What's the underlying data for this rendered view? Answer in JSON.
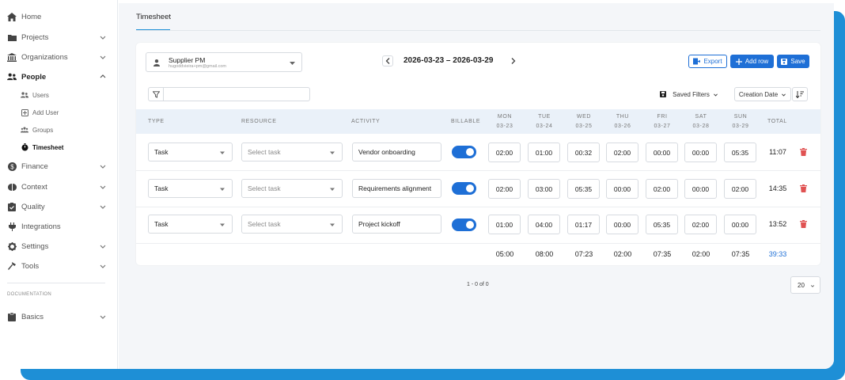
{
  "sidebar": {
    "items": [
      {
        "label": "Home",
        "icon": "home-icon"
      },
      {
        "label": "Projects",
        "icon": "folder-icon"
      },
      {
        "label": "Organizations",
        "icon": "bank-icon"
      },
      {
        "label": "People",
        "icon": "people-icon"
      },
      {
        "label": "Finance",
        "icon": "dollar-icon"
      },
      {
        "label": "Context",
        "icon": "brain-icon"
      },
      {
        "label": "Quality",
        "icon": "clipboard-check-icon"
      },
      {
        "label": "Integrations",
        "icon": "plug-icon"
      },
      {
        "label": "Settings",
        "icon": "gear-icon"
      },
      {
        "label": "Tools",
        "icon": "hammer-icon"
      }
    ],
    "sub_items": [
      {
        "label": "Users"
      },
      {
        "label": "Add User"
      },
      {
        "label": "Groups"
      },
      {
        "label": "Timesheet"
      }
    ],
    "doc_label": "DOCUMENTATION",
    "doc_items": [
      {
        "label": "Basics",
        "icon": "clipboard-icon"
      }
    ]
  },
  "page": {
    "title": "Timesheet"
  },
  "toolbar": {
    "supplier_name": "Supplier PM",
    "supplier_email": "hugoddvieira+pm@gmail.com",
    "date_range": "2026-03-23 – 2026-03-29",
    "export_label": "Export",
    "add_row_label": "Add row",
    "save_label": "Save",
    "filter_placeholder": "",
    "saved_filters_label": "Saved Filters",
    "sort_label": "Creation Date"
  },
  "table": {
    "headers": {
      "type": "TYPE",
      "resource": "RESOURCE",
      "activity": "ACTIVITY",
      "billable": "BILLABLE",
      "total": "TOTAL"
    },
    "days": [
      {
        "day": "MON",
        "date": "03-23"
      },
      {
        "day": "TUE",
        "date": "03-24"
      },
      {
        "day": "WED",
        "date": "03-25"
      },
      {
        "day": "THU",
        "date": "03-26"
      },
      {
        "day": "FRI",
        "date": "03-27"
      },
      {
        "day": "SAT",
        "date": "03-28"
      },
      {
        "day": "SUN",
        "date": "03-29"
      }
    ],
    "rows": [
      {
        "type": "Task",
        "resource": "Select task",
        "activity": "Vendor onboarding",
        "billable": true,
        "times": [
          "02:00",
          "01:00",
          "00:32",
          "02:00",
          "00:00",
          "00:00",
          "05:35"
        ],
        "total": "11:07"
      },
      {
        "type": "Task",
        "resource": "Select task",
        "activity": "Requirements alignment",
        "billable": true,
        "times": [
          "02:00",
          "03:00",
          "05:35",
          "00:00",
          "02:00",
          "00:00",
          "02:00"
        ],
        "total": "14:35"
      },
      {
        "type": "Task",
        "resource": "Select task",
        "activity": "Project kickoff",
        "billable": true,
        "times": [
          "01:00",
          "04:00",
          "01:17",
          "00:00",
          "05:35",
          "02:00",
          "00:00"
        ],
        "total": "13:52"
      }
    ],
    "column_totals": [
      "05:00",
      "08:00",
      "07:23",
      "02:00",
      "07:35",
      "02:00",
      "07:35"
    ],
    "grand_total": "39:33"
  },
  "pagination": {
    "summary": "1 - 0 of 0",
    "page_size": "20"
  },
  "colors": {
    "accent": "#1e6fd6",
    "frame": "#1e8fd6",
    "danger": "#e05252",
    "header_bg": "#eaf1f9"
  }
}
